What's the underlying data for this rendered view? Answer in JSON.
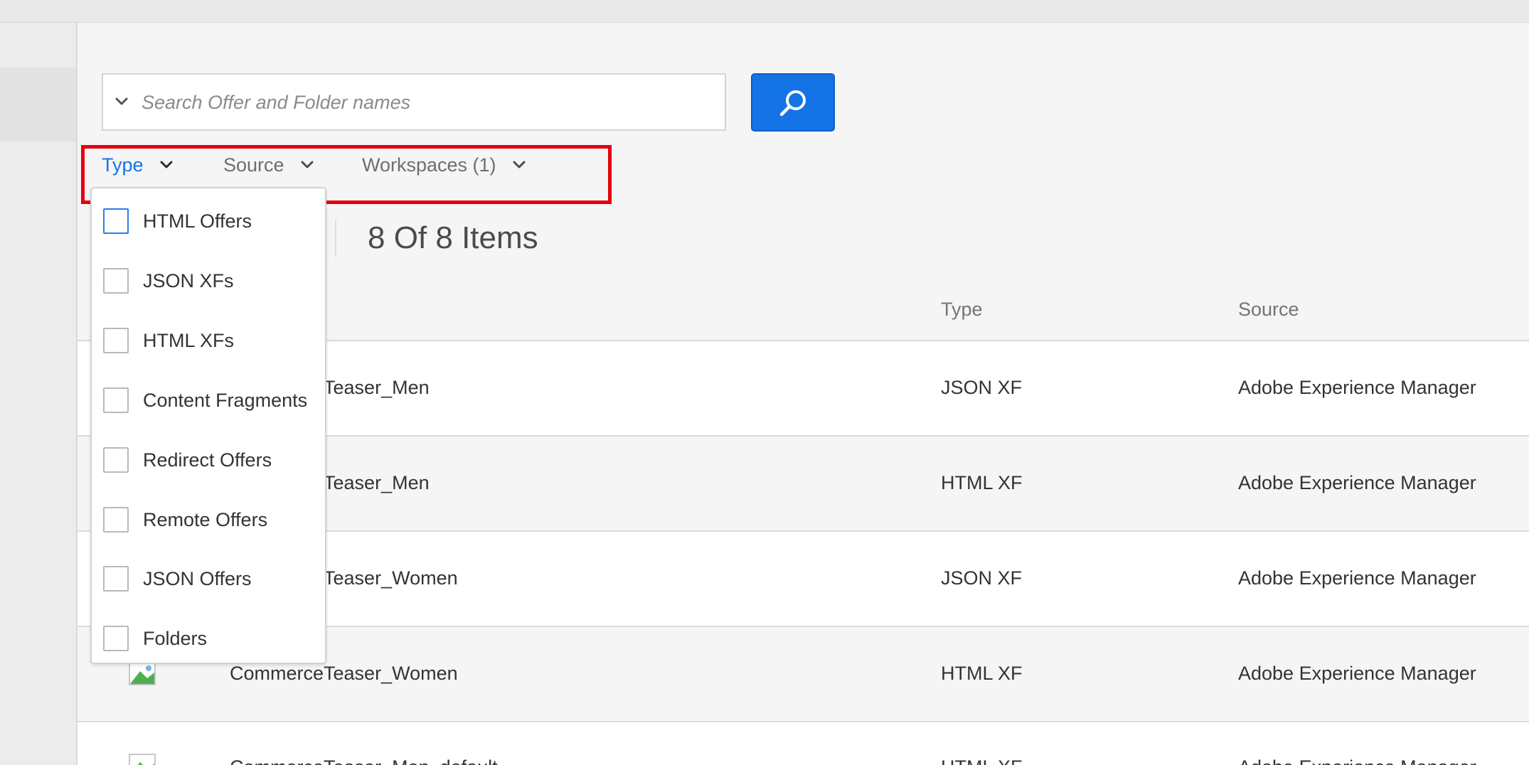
{
  "search": {
    "placeholder": "Search Offer and Folder names"
  },
  "filters": [
    {
      "label": "Type",
      "active": true
    },
    {
      "label": "Source",
      "active": false
    },
    {
      "label": "Workspaces (1)",
      "active": false
    }
  ],
  "count_label": "8 Of 8 Items",
  "table": {
    "columns": [
      "Type",
      "Source"
    ],
    "rows": [
      {
        "name": "CommerceTeaser_Men",
        "type": "JSON XF",
        "source": "Adobe Experience Manager"
      },
      {
        "name": "CommerceTeaser_Men",
        "type": "HTML XF",
        "source": "Adobe Experience Manager"
      },
      {
        "name": "CommerceTeaser_Women",
        "type": "JSON XF",
        "source": "Adobe Experience Manager"
      },
      {
        "name": "CommerceTeaser_Women",
        "type": "HTML XF",
        "source": "Adobe Experience Manager"
      },
      {
        "name": "CommerceTeaser_Men_default",
        "type": "HTML XF",
        "source": "Adobe Experience Manager"
      }
    ]
  },
  "type_dropdown": {
    "options": [
      "HTML Offers",
      "JSON XFs",
      "HTML XFs",
      "Content Fragments",
      "Redirect Offers",
      "Remote Offers",
      "JSON Offers",
      "Folders"
    ]
  },
  "colors": {
    "accent": "#1473e6",
    "highlight": "#e3000f"
  },
  "icons": [
    "chevron-down-icon",
    "search-icon",
    "offer-thumbnail-icon"
  ]
}
